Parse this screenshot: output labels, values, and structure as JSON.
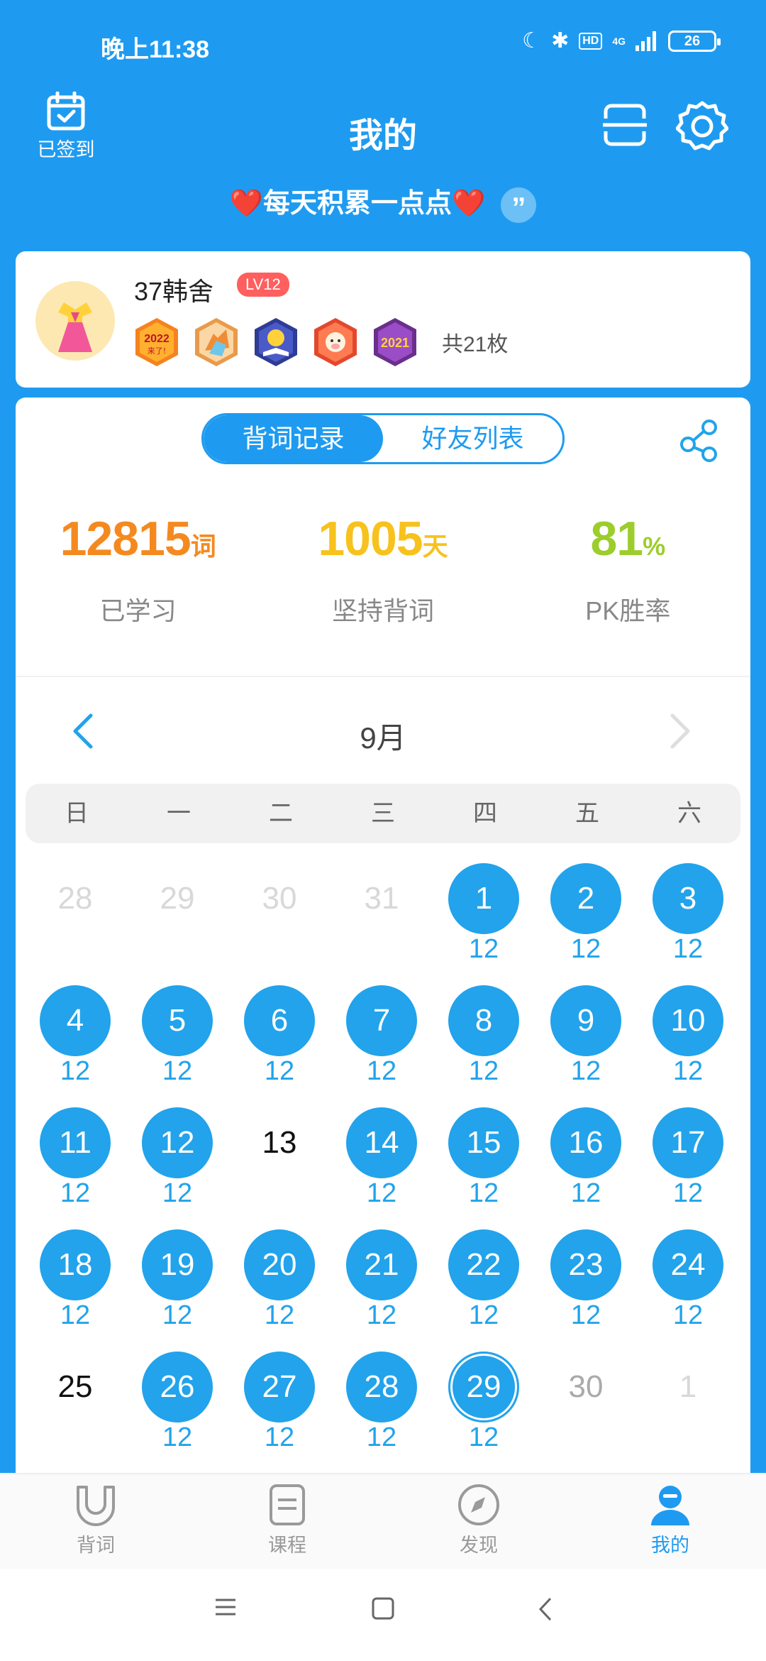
{
  "status_bar": {
    "time": "晚上11:38",
    "network": "4G",
    "hd": "HD",
    "battery": "26"
  },
  "header": {
    "checkin_label": "已签到",
    "title": "我的",
    "motto": "❤️每天积累一点点❤️"
  },
  "profile": {
    "username": "37韩舍",
    "level": "LV12",
    "badge_count": "共21枚",
    "badges": [
      "2022 来了!",
      "hands",
      "book",
      "ox",
      "2021"
    ]
  },
  "tabs": {
    "active": "背词记录",
    "inactive": "好友列表"
  },
  "stats": [
    {
      "value": "12815",
      "unit": "词",
      "label": "已学习",
      "color": "#f48a1f"
    },
    {
      "value": "1005",
      "unit": "天",
      "label": "坚持背词",
      "color": "#f7c21d"
    },
    {
      "value": "81",
      "unit": "%",
      "label": "PK胜率",
      "color": "#9ccd2d"
    }
  ],
  "calendar": {
    "month": "9月",
    "weekdays": [
      "日",
      "一",
      "二",
      "三",
      "四",
      "五",
      "六"
    ],
    "weeks": [
      [
        {
          "d": "28",
          "s": "dim"
        },
        {
          "d": "29",
          "s": "dim"
        },
        {
          "d": "30",
          "s": "dim"
        },
        {
          "d": "31",
          "s": "dim"
        },
        {
          "d": "1",
          "s": "done",
          "c": "12"
        },
        {
          "d": "2",
          "s": "done",
          "c": "12"
        },
        {
          "d": "3",
          "s": "done",
          "c": "12"
        }
      ],
      [
        {
          "d": "4",
          "s": "done",
          "c": "12"
        },
        {
          "d": "5",
          "s": "done",
          "c": "12"
        },
        {
          "d": "6",
          "s": "done",
          "c": "12"
        },
        {
          "d": "7",
          "s": "done",
          "c": "12"
        },
        {
          "d": "8",
          "s": "done",
          "c": "12"
        },
        {
          "d": "9",
          "s": "done",
          "c": "12"
        },
        {
          "d": "10",
          "s": "done",
          "c": "12"
        }
      ],
      [
        {
          "d": "11",
          "s": "done",
          "c": "12"
        },
        {
          "d": "12",
          "s": "done",
          "c": "12"
        },
        {
          "d": "13",
          "s": "plain"
        },
        {
          "d": "14",
          "s": "done",
          "c": "12"
        },
        {
          "d": "15",
          "s": "done",
          "c": "12"
        },
        {
          "d": "16",
          "s": "done",
          "c": "12"
        },
        {
          "d": "17",
          "s": "done",
          "c": "12"
        }
      ],
      [
        {
          "d": "18",
          "s": "done",
          "c": "12"
        },
        {
          "d": "19",
          "s": "done",
          "c": "12"
        },
        {
          "d": "20",
          "s": "done",
          "c": "12"
        },
        {
          "d": "21",
          "s": "done",
          "c": "12"
        },
        {
          "d": "22",
          "s": "done",
          "c": "12"
        },
        {
          "d": "23",
          "s": "done",
          "c": "12"
        },
        {
          "d": "24",
          "s": "done",
          "c": "12"
        }
      ],
      [
        {
          "d": "25",
          "s": "plain"
        },
        {
          "d": "26",
          "s": "done",
          "c": "12"
        },
        {
          "d": "27",
          "s": "done",
          "c": "12"
        },
        {
          "d": "28",
          "s": "done",
          "c": "12"
        },
        {
          "d": "29",
          "s": "done today",
          "c": "12"
        },
        {
          "d": "30",
          "s": "muted"
        },
        {
          "d": "1",
          "s": "dim"
        }
      ]
    ]
  },
  "bottom_nav": [
    {
      "label": "背词",
      "icon": "cup-icon"
    },
    {
      "label": "课程",
      "icon": "course-icon"
    },
    {
      "label": "发现",
      "icon": "compass-icon"
    },
    {
      "label": "我的",
      "icon": "profile-icon",
      "active": true
    }
  ],
  "colors": {
    "primary": "#1e9bf0"
  }
}
